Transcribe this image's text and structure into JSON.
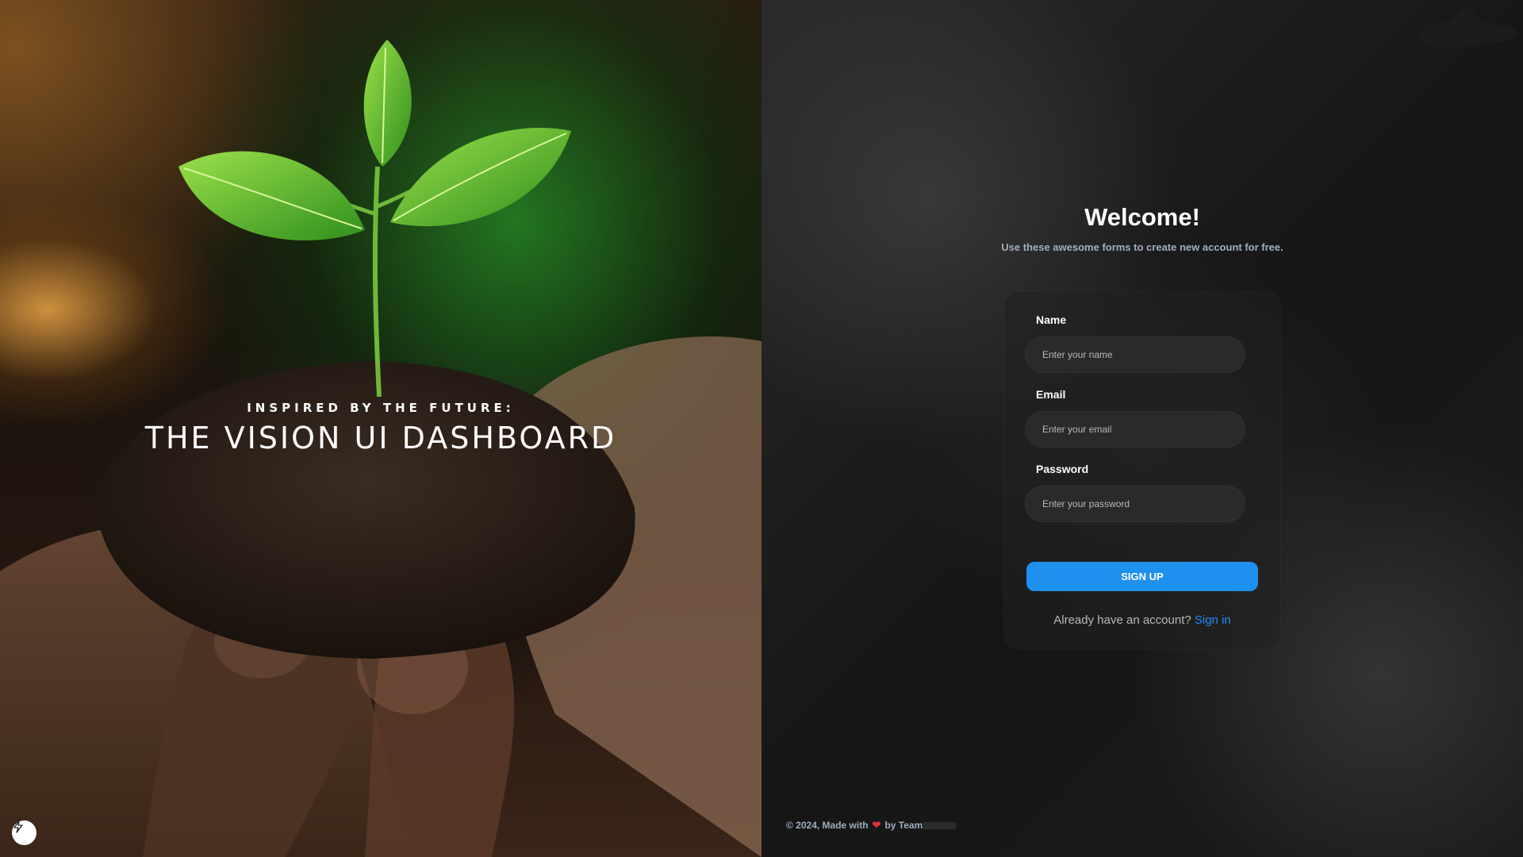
{
  "hero": {
    "eyebrow": "INSPIRED BY THE FUTURE:",
    "title": "THE VISION UI DASHBOARD",
    "quick_action_icon": "bolt-icon"
  },
  "signup": {
    "heading": "Welcome!",
    "subtitle": "Use these awesome forms to create new account for free.",
    "name_label": "Name",
    "name_placeholder": "Enter your name",
    "email_label": "Email",
    "email_placeholder": "Enter your email",
    "password_label": "Password",
    "password_placeholder": "Enter your password",
    "button_label": "SIGN UP",
    "signin_prompt": "Already have an account?",
    "signin_link": "Sign in"
  },
  "footer": {
    "prefix": "© 2024, Made with",
    "heart_icon": "heart-icon",
    "suffix": "by Team"
  },
  "colors": {
    "accent": "#1e90ee",
    "link": "#1e8bff",
    "muted_text": "#a0aec0",
    "heart": "#e0303a"
  }
}
